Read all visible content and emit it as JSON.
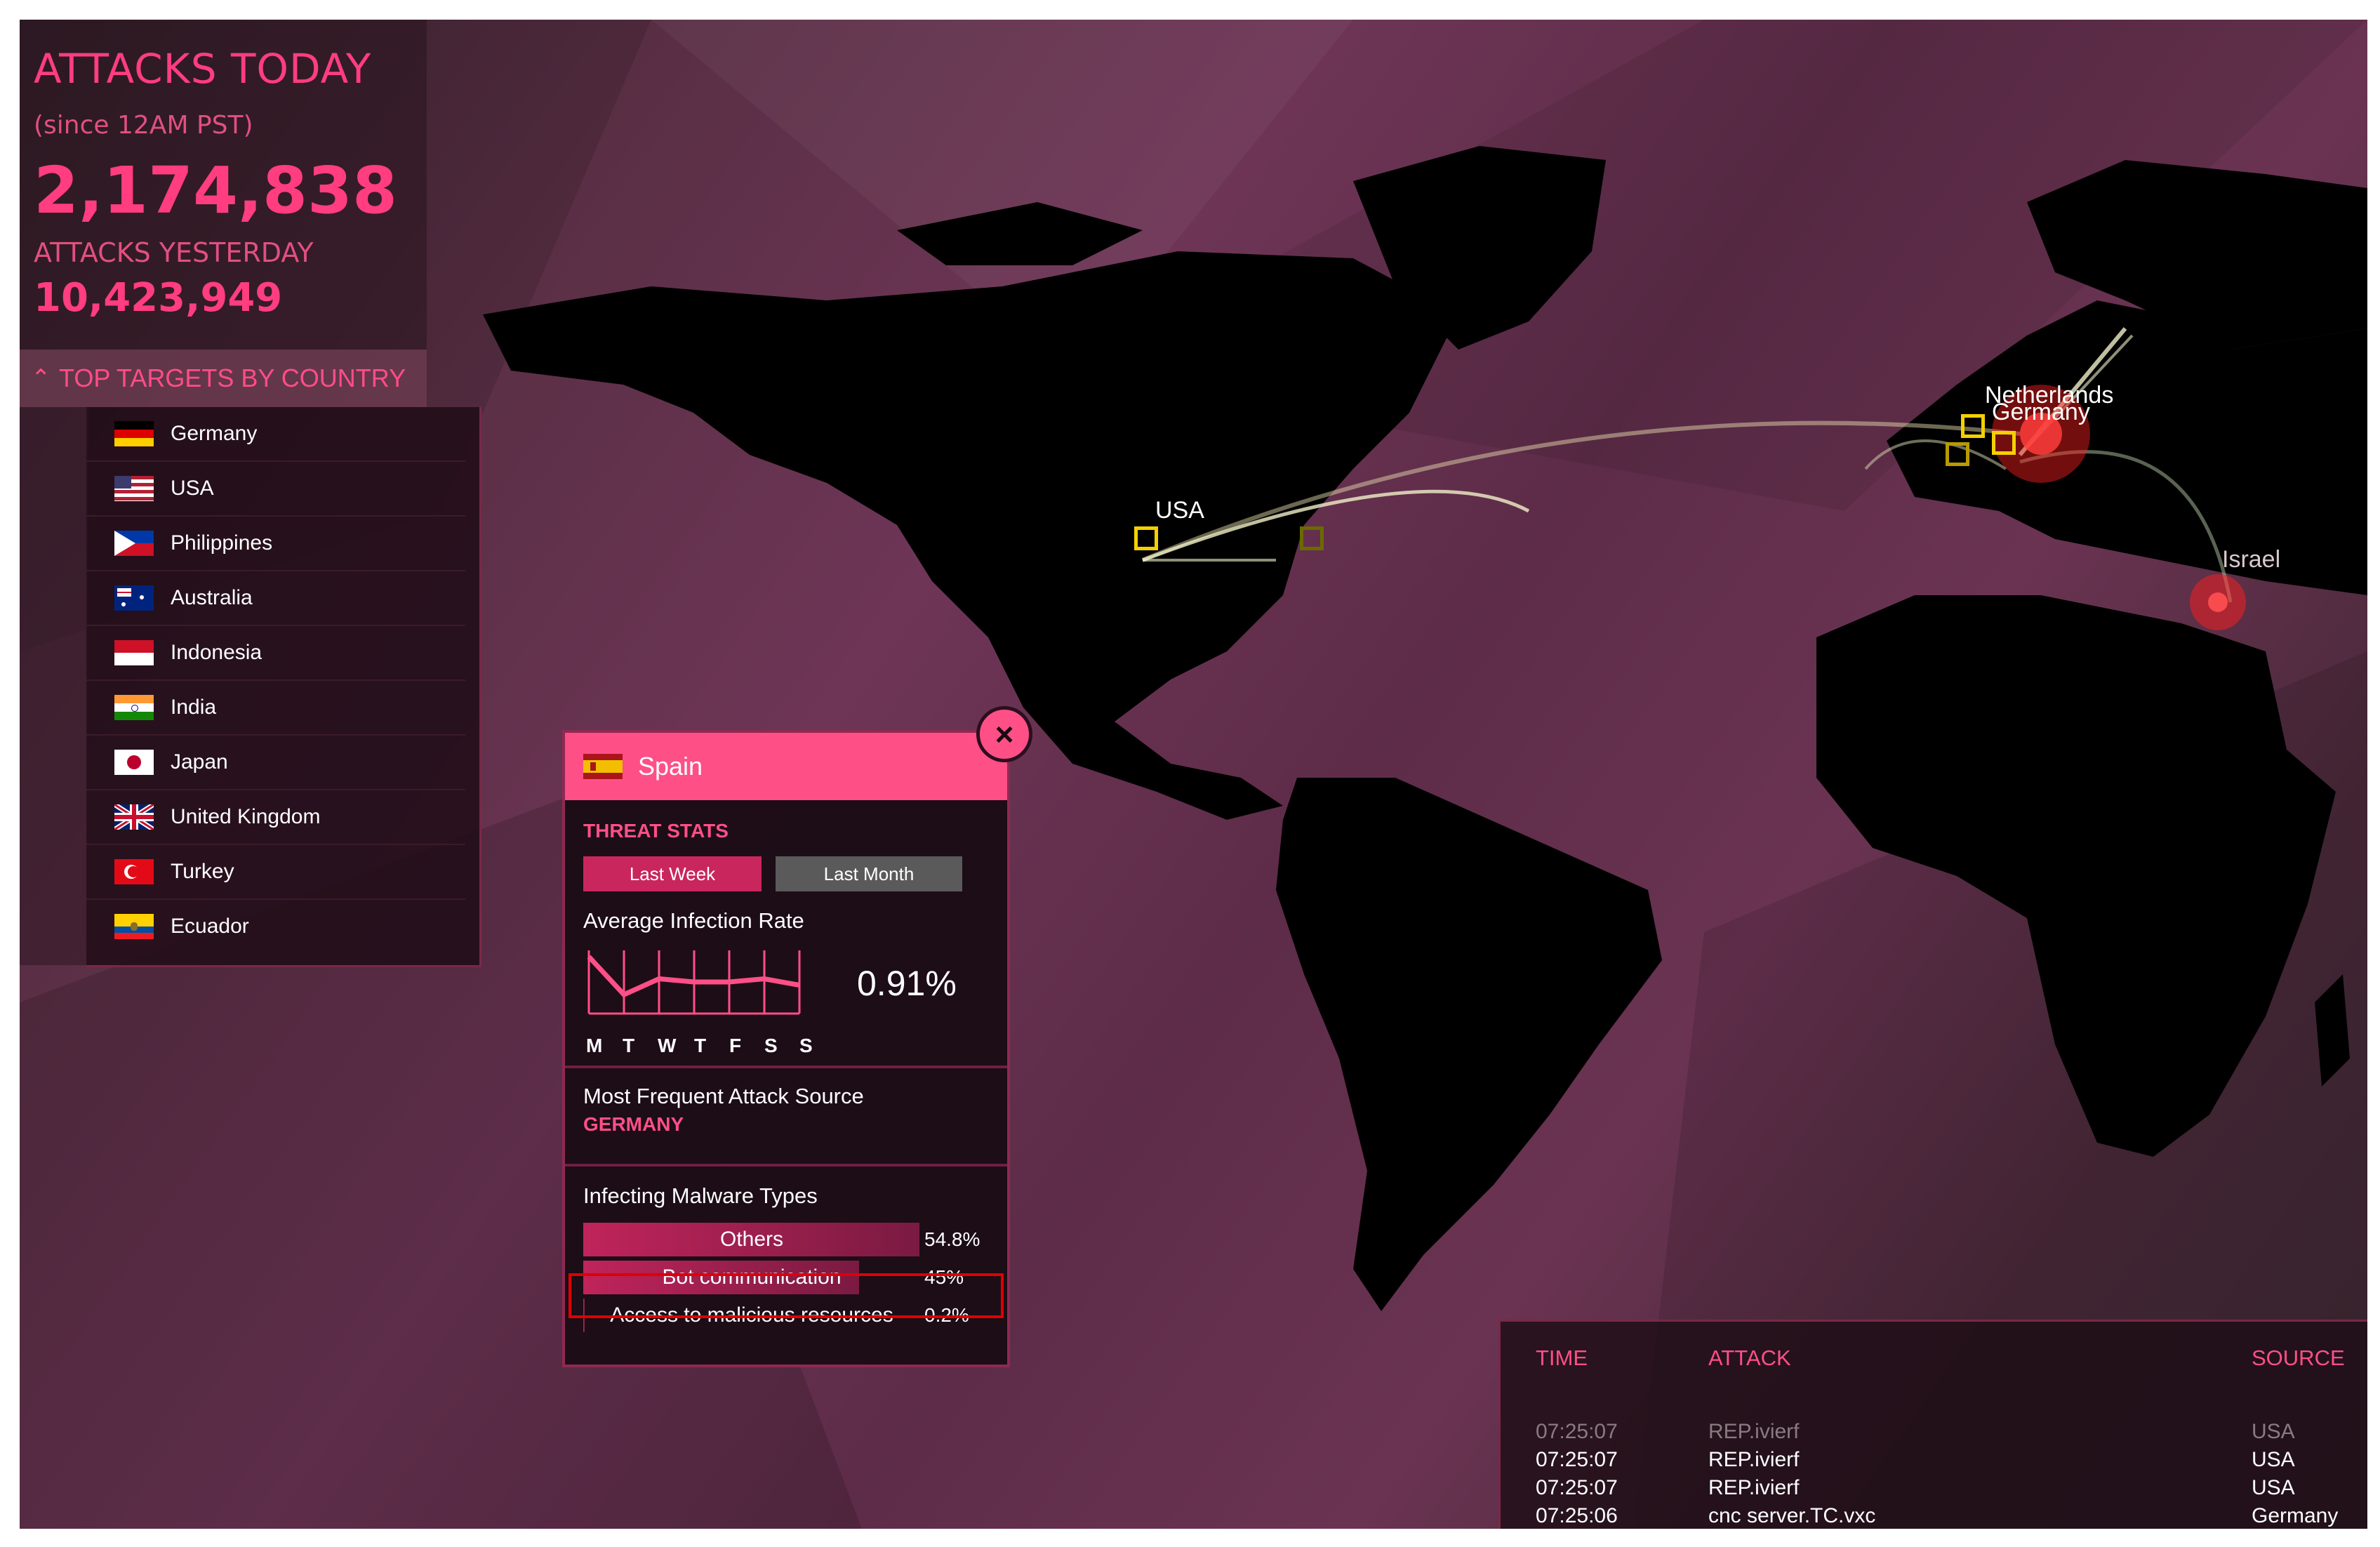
{
  "stats": {
    "attacks_today_title": "ATTACKS TODAY",
    "attacks_today_since": "(since 12AM PST)",
    "attacks_today_value": "2,174,838",
    "attacks_yesterday_title": "ATTACKS YESTERDAY",
    "attacks_yesterday_value": "10,423,949"
  },
  "targets": {
    "header": "TOP TARGETS BY COUNTRY",
    "countries": [
      {
        "name": "Germany",
        "flag": "germany-flag"
      },
      {
        "name": "USA",
        "flag": "usa-flag"
      },
      {
        "name": "Philippines",
        "flag": "philippines-flag"
      },
      {
        "name": "Australia",
        "flag": "australia-flag"
      },
      {
        "name": "Indonesia",
        "flag": "indonesia-flag"
      },
      {
        "name": "India",
        "flag": "india-flag"
      },
      {
        "name": "Japan",
        "flag": "japan-flag"
      },
      {
        "name": "United Kingdom",
        "flag": "uk-flag"
      },
      {
        "name": "Turkey",
        "flag": "turkey-flag"
      },
      {
        "name": "Ecuador",
        "flag": "ecuador-flag"
      }
    ]
  },
  "popup": {
    "country": "Spain",
    "flag": "spain-flag",
    "threat_stats_label": "THREAT STATS",
    "tabs": [
      "Last Week",
      "Last Month"
    ],
    "active_tab": "Last Week",
    "avg_infection_label": "Average Infection Rate",
    "avg_infection_value": "0.91%",
    "days": [
      "M",
      "T",
      "W",
      "T",
      "F",
      "S",
      "S"
    ],
    "sparkline": [
      0.9,
      0.3,
      0.55,
      0.5,
      0.5,
      0.55,
      0.45
    ],
    "attack_source_label": "Most Frequent Attack Source",
    "attack_source_value": "GERMANY",
    "malware_label": "Infecting Malware Types",
    "malware": [
      {
        "name": "Others",
        "pct": "54.8%",
        "value": 54.8
      },
      {
        "name": "Bot communication",
        "pct": "45%",
        "value": 45
      },
      {
        "name": "Access to malicious resources",
        "pct": "0.2%",
        "value": 0.2
      }
    ]
  },
  "map": {
    "labels": [
      "USA",
      "Netherlands",
      "Germany",
      "Israel"
    ]
  },
  "log": {
    "headers": {
      "time": "TIME",
      "attack": "ATTACK",
      "source": "SOURCE"
    },
    "rows": [
      {
        "time": "07:25:07",
        "attack": "REP.ivierf",
        "source": "USA",
        "faded": true
      },
      {
        "time": "07:25:07",
        "attack": "REP.ivierf",
        "source": "USA",
        "faded": false
      },
      {
        "time": "07:25:07",
        "attack": "REP.ivierf",
        "source": "USA",
        "faded": false
      },
      {
        "time": "07:25:06",
        "attack": "cnc server.TC.vxc",
        "source": "Germany",
        "faded": false
      }
    ]
  },
  "colors": {
    "accent": "#ff4f87",
    "highlight": "#e00000"
  }
}
